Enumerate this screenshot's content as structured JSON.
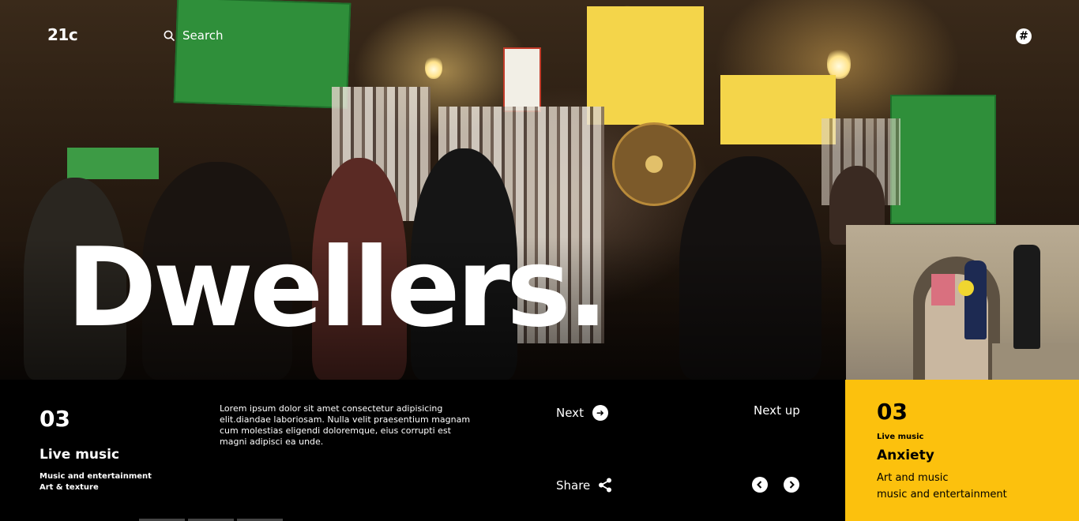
{
  "header": {
    "logo": "21c",
    "search_label": "Search",
    "menu_icon": "hash-icon"
  },
  "hero": {
    "title": "Dwellers."
  },
  "current": {
    "number": "03",
    "title": "Live music",
    "meta_line1": "Music and entertainment",
    "meta_line2": "Art & texture",
    "description": "Lorem ipsum dolor sit amet consectetur adipisicing elit.diandae laboriosam. Nulla velit praesentium magnam cum molestias eligendi doloremque, eius corrupti est magni adipisci ea unde."
  },
  "actions": {
    "next_label": "Next",
    "next_up_label": "Next up",
    "share_label": "Share"
  },
  "next_card": {
    "number": "03",
    "category": "Live music",
    "title": "Anxiety",
    "sub_line1": "Art and music",
    "sub_line2": "music and entertainment"
  },
  "colors": {
    "accent": "#fcc10d",
    "background": "#000000",
    "text": "#ffffff"
  }
}
